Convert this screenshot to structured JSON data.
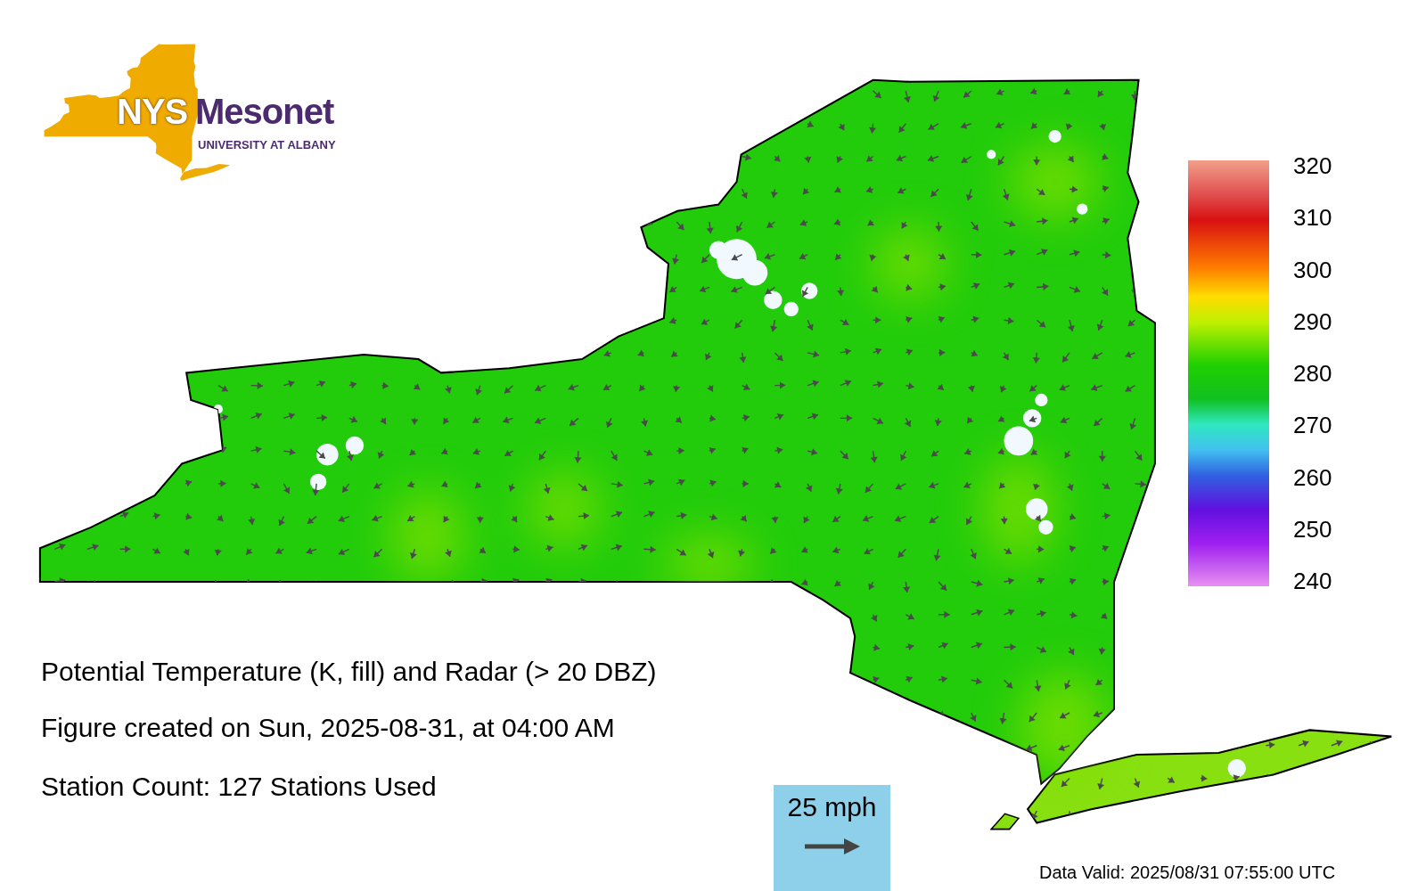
{
  "logo": {
    "brand": "NYS",
    "name": "Mesonet",
    "subtitle": "UNIVERSITY AT ALBANY"
  },
  "colorbar": {
    "ticks": [
      "320",
      "310",
      "300",
      "290",
      "280",
      "270",
      "260",
      "250",
      "240"
    ]
  },
  "captions": [
    "Potential Temperature (K, fill) and Radar (> 20 DBZ)",
    "Figure created on Sun, 2025-08-31, at 04:00 AM",
    "Station Count: 127 Stations Used"
  ],
  "scale": {
    "label": "25 mph"
  },
  "valid_time": "Data Valid: 2025/08/31 07:55:00 UTC"
}
